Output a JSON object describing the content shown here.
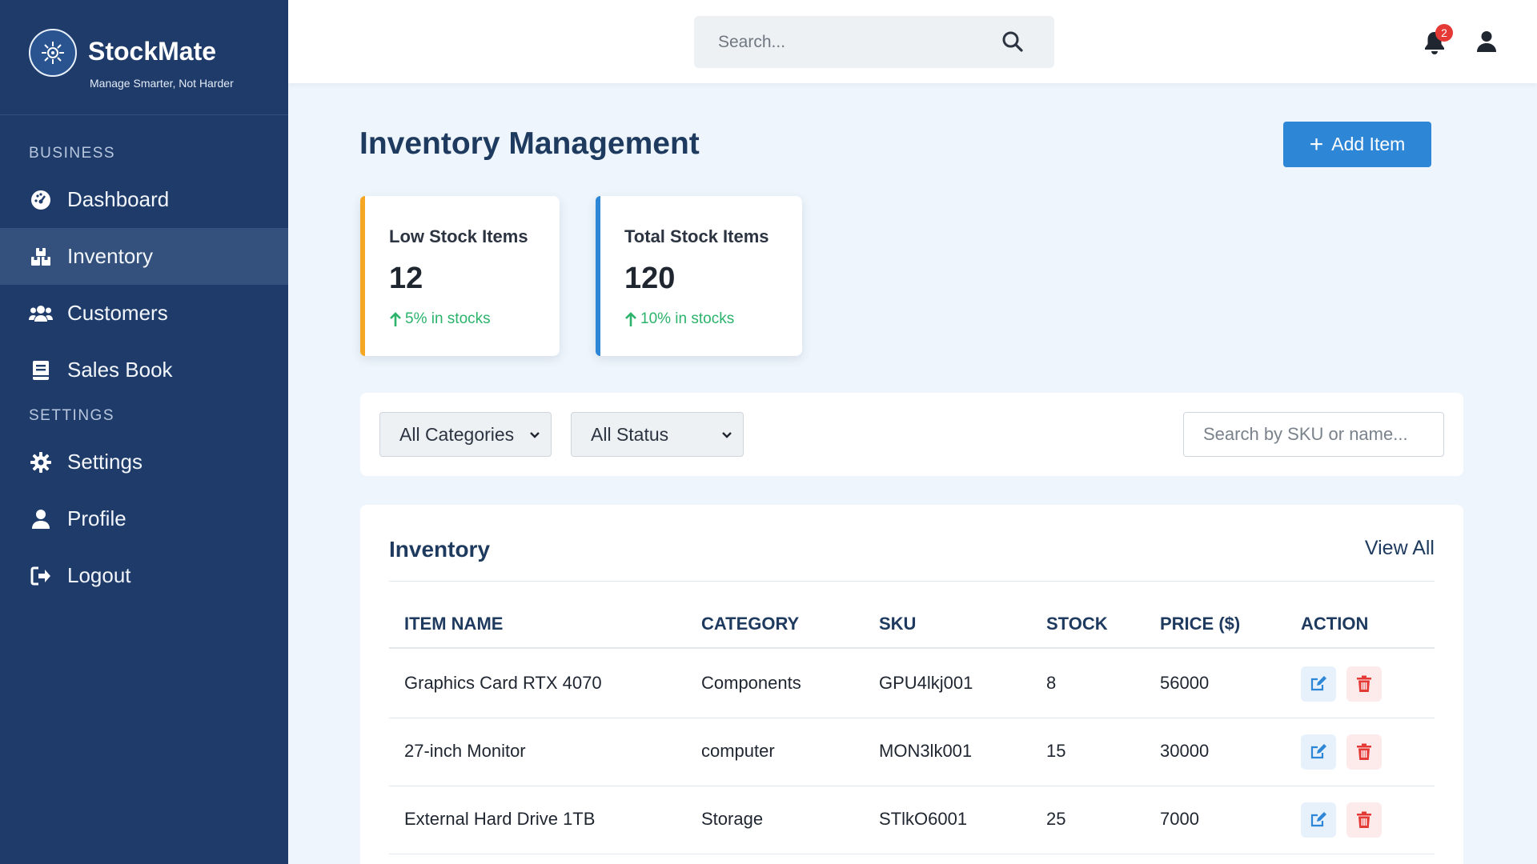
{
  "brand": {
    "name": "StockMate",
    "tagline": "Manage Smarter, Not Harder"
  },
  "sidebar": {
    "sections": [
      {
        "title": "BUSINESS"
      },
      {
        "title": "SETTINGS"
      }
    ],
    "items": [
      {
        "label": "Dashboard",
        "icon": "dashboard-gauge-icon"
      },
      {
        "label": "Inventory",
        "icon": "boxes-icon",
        "active": true
      },
      {
        "label": "Customers",
        "icon": "users-icon"
      },
      {
        "label": "Sales Book",
        "icon": "book-icon"
      },
      {
        "label": "Settings",
        "icon": "gear-icon"
      },
      {
        "label": "Profile",
        "icon": "user-icon"
      },
      {
        "label": "Logout",
        "icon": "sign-out-icon"
      }
    ]
  },
  "header": {
    "search_placeholder": "Search...",
    "notification_count": "2"
  },
  "main": {
    "title": "Inventory Management",
    "add_button_label": "Add Item",
    "stats": [
      {
        "label": "Low Stock Items",
        "value": "12",
        "trend": "5% in stocks",
        "accent": "#f5a623"
      },
      {
        "label": "Total Stock Items",
        "value": "120",
        "trend": "10% in stocks",
        "accent": "#2e86d6"
      }
    ],
    "filters": {
      "category_selected": "All Categories",
      "status_selected": "All Status",
      "search_placeholder": "Search by SKU or name..."
    },
    "table": {
      "title": "Inventory",
      "view_all": "View All",
      "columns": [
        "ITEM NAME",
        "CATEGORY",
        "SKU",
        "STOCK",
        "PRICE ($)",
        "ACTION"
      ],
      "rows": [
        [
          "Graphics Card RTX 4070",
          "Components",
          "GPU4lkj001",
          "8",
          "56000"
        ],
        [
          "27-inch Monitor",
          "computer",
          "MON3lk001",
          "15",
          "30000"
        ],
        [
          "External Hard Drive 1TB",
          "Storage",
          "STlkO6001",
          "25",
          "7000"
        ]
      ]
    }
  },
  "colors": {
    "sidebar_bg": "#1f3b6a",
    "sidebar_active": "#34507d",
    "primary": "#2e86d6",
    "success": "#2bb36b",
    "danger": "#e53935",
    "page_bg": "#eef5fc"
  }
}
